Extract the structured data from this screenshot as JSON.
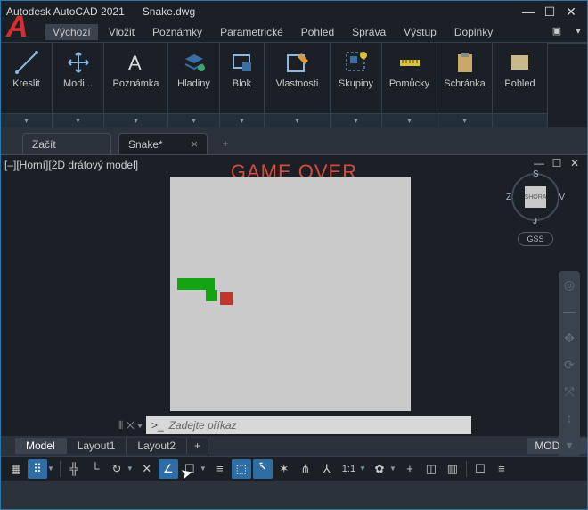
{
  "titlebar": {
    "app": "Autodesk AutoCAD 2021",
    "file": "Snake.dwg",
    "logo": "A",
    "min": "—",
    "max": "☐",
    "close": "✕"
  },
  "menubar": {
    "items": [
      "Výchozí",
      "Vložit",
      "Poznámky",
      "Parametrické",
      "Pohled",
      "Správa",
      "Výstup",
      "Doplňky"
    ],
    "active_index": 0,
    "extra": [
      "▣",
      "▾"
    ]
  },
  "ribbon": {
    "panels": [
      {
        "label": "Kreslit",
        "icon": "line"
      },
      {
        "label": "Modi...",
        "icon": "move"
      },
      {
        "label": "Poznámka",
        "icon": "text"
      },
      {
        "label": "Hladiny",
        "icon": "layers"
      },
      {
        "label": "Blok",
        "icon": "block"
      },
      {
        "label": "Vlastnosti",
        "icon": "props"
      },
      {
        "label": "Skupiny",
        "icon": "group"
      },
      {
        "label": "Pomůcky",
        "icon": "measure"
      },
      {
        "label": "Schránka",
        "icon": "clip"
      },
      {
        "label": "Pohled",
        "icon": "view"
      }
    ],
    "splitter": "▾"
  },
  "doctabs": {
    "tabs": [
      {
        "label": "Začít",
        "current": false,
        "closable": false
      },
      {
        "label": "Snake*",
        "current": true,
        "closable": true
      }
    ],
    "close_glyph": "×",
    "add_glyph": "+"
  },
  "workspace": {
    "viewlabel": "[–][Horní][2D drátový model]",
    "gameover": "GAME OVER",
    "viewctrls": [
      "—",
      "☐",
      "✕"
    ],
    "cubeface": "SHORA",
    "cube_letters": {
      "S": "S",
      "Z": "Z",
      "V": "V",
      "J": "J"
    },
    "gss": "GSS",
    "cmd_ghost": "⦀ ✕  ▾",
    "cmd_prompt": ">_",
    "cmd_placeholder": "Zadejte příkaz",
    "nav": [
      "◎",
      "—",
      "✥",
      "⟳",
      "⤧",
      "↕",
      "▾"
    ]
  },
  "layouts": {
    "tabs": [
      "Model",
      "Layout1",
      "Layout2"
    ],
    "current_index": 0,
    "add": "+",
    "modelp": "MODELP"
  },
  "statusbar": {
    "items": [
      {
        "g": "▦",
        "on": false
      },
      {
        "g": "⠿",
        "on": true
      },
      {
        "dd": true
      },
      {
        "sep": true
      },
      {
        "g": "╬",
        "on": false
      },
      {
        "g": "└",
        "on": false
      },
      {
        "g": "↻",
        "on": false
      },
      {
        "dd": true
      },
      {
        "g": "✕",
        "on": false
      },
      {
        "g": "∠",
        "on": true
      },
      {
        "g": "☐",
        "on": false
      },
      {
        "dd": true
      },
      {
        "g": "≡",
        "on": false
      },
      {
        "g": "⬚",
        "on": true
      },
      {
        "g": "⭶",
        "on": true
      },
      {
        "g": "✶",
        "on": false
      },
      {
        "g": "⋔",
        "on": false
      },
      {
        "g": "⅄",
        "on": false
      },
      {
        "g": "1:1",
        "on": false,
        "wide": true
      },
      {
        "dd": true
      },
      {
        "g": "✿",
        "on": false
      },
      {
        "dd": true
      },
      {
        "g": "+",
        "on": false
      },
      {
        "g": "◫",
        "on": false
      },
      {
        "g": "▥",
        "on": false
      },
      {
        "sep": true
      },
      {
        "g": "☐",
        "on": false
      },
      {
        "g": "≡",
        "on": false
      }
    ]
  }
}
